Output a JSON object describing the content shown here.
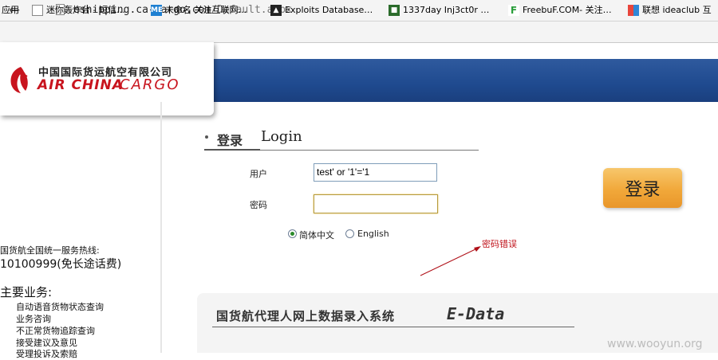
{
  "browser": {
    "url_host": "eshipping.ca-cargo.com",
    "url_path": "/Default.aspx",
    "bookmarks": [
      {
        "label": "应用",
        "icon": "apps-grid-icon"
      },
      {
        "label": "迷你轰炸台 - 短信…",
        "icon": "page-icon"
      },
      {
        "label": "未命名 关注互联网…",
        "icon": "me-site-icon"
      },
      {
        "label": "Exploits Database…",
        "icon": "exploit-db-icon"
      },
      {
        "label": "1337day Inj3ct0r …",
        "icon": "1337day-icon"
      },
      {
        "label": "FreebuF.COM- 关注…",
        "icon": "freebuf-icon"
      },
      {
        "label": "联想 ideaclub 互",
        "icon": "lenovo-icon"
      }
    ]
  },
  "logo": {
    "cn": "中国国际货运航空有限公司",
    "en_left": "AIR CHINA",
    "en_right": "CARGO"
  },
  "login": {
    "heading_cn": "登录",
    "heading_en": "Login",
    "username_label": "用户",
    "username_value": "test' or '1'='1",
    "password_label": "密码",
    "password_value": "",
    "lang_cn": "简体中文",
    "lang_en": "English",
    "lang_selected": "简体中文",
    "button_label": "登录",
    "error_text": "密码错误"
  },
  "sidebar": {
    "hotline_label": "国货航全国统一服务热线:",
    "hotline_number": "10100999(免长途话费)",
    "services_title": "主要业务:",
    "services": [
      "自动语音货物状态查询",
      "业务咨询",
      "不正常货物追踪查询",
      "接受建议及意见",
      "受理投诉及索赔"
    ]
  },
  "edata": {
    "title_cn": "国货航代理人网上数据录入系统",
    "title_en": "E-Data"
  },
  "watermark": "www.wooyun.org",
  "colors": {
    "banner": "#1f4a8f",
    "brand_red": "#c8141e",
    "button": "#f1a83a",
    "error": "#c0141c"
  }
}
